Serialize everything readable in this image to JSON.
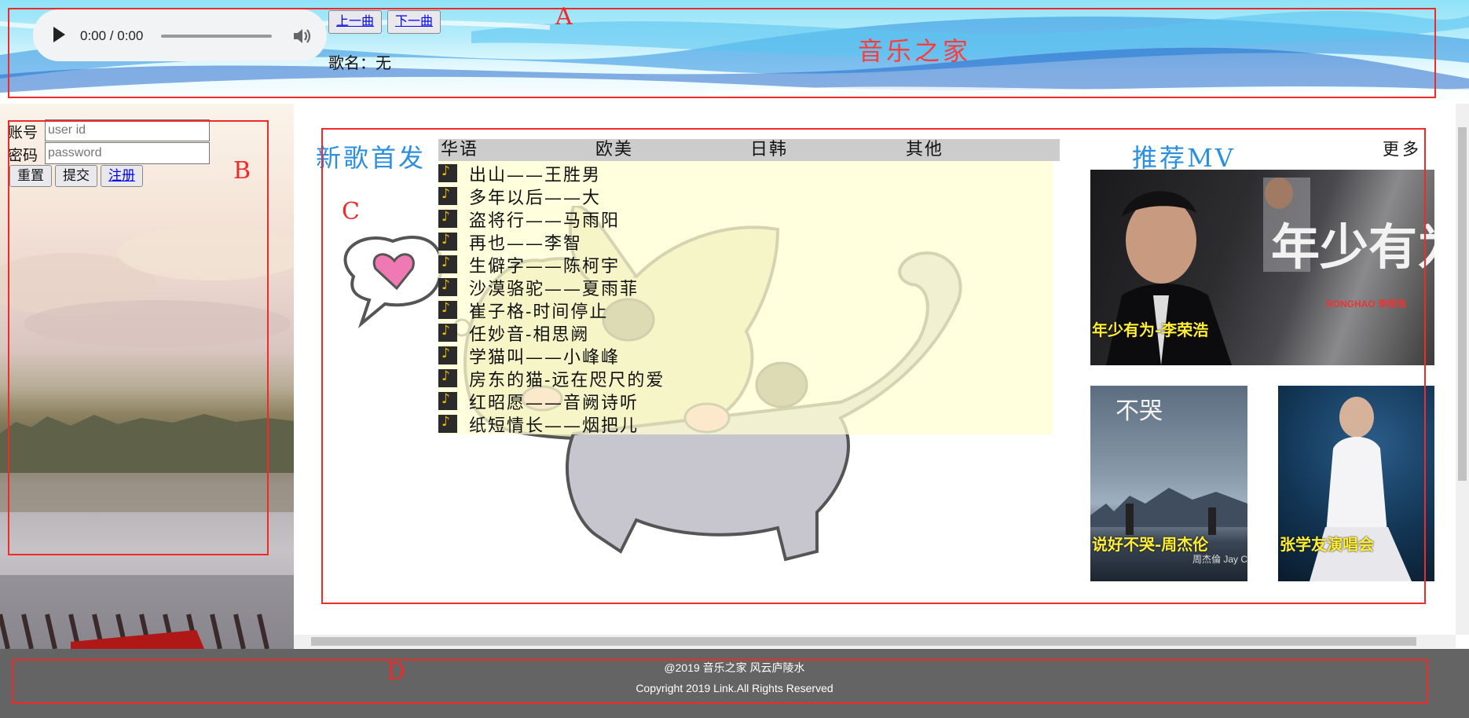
{
  "header": {
    "player": {
      "time": "0:00 / 0:00"
    },
    "prev_label": "上一曲",
    "next_label": "下一曲",
    "song_label": "歌名：无",
    "site_title": "音乐之家"
  },
  "login": {
    "account_label": "账号",
    "account_placeholder": "user id",
    "password_label": "密码",
    "password_placeholder": "password",
    "reset_label": "重置",
    "submit_label": "提交",
    "register_label": "注册"
  },
  "main": {
    "new_songs_title": "新歌首发",
    "tabs": [
      "华语",
      "欧美",
      "日韩",
      "其他"
    ],
    "songs": [
      "出山——王胜男",
      "多年以后——大",
      "盗将行——马雨阳",
      "再也——李智",
      "生僻字——陈柯宇",
      "沙漠骆驼——夏雨菲",
      "崔子格-时间停止",
      "任妙音-相思阙",
      "学猫叫——小峰峰",
      "房东的猫-远在咫尺的爱",
      "红昭愿——音阙诗听",
      "纸短情长——烟把儿"
    ],
    "mv_title": "推荐MV",
    "more_label": "更多",
    "mvs": [
      {
        "caption": "年少有为-李荣浩",
        "poster_text": "年少有为",
        "poster_sub": "RONGHAO 李荣浩"
      },
      {
        "caption": "说好不哭-周杰伦",
        "poster_text": "不哭",
        "poster_sub": "周杰倫 Jay Chou"
      },
      {
        "caption": "张学友演唱会"
      }
    ]
  },
  "footer": {
    "line1": "@2019 音乐之家 风云庐陵水",
    "line2": "Copyright 2019 Link.All Rights Reserved"
  },
  "annotations": [
    "A",
    "B",
    "C",
    "D"
  ],
  "colors": {
    "annotation": "#ee2a2a",
    "title_blue": "#2b8fe0",
    "footer": "#646464",
    "caption": "#ffee33"
  }
}
